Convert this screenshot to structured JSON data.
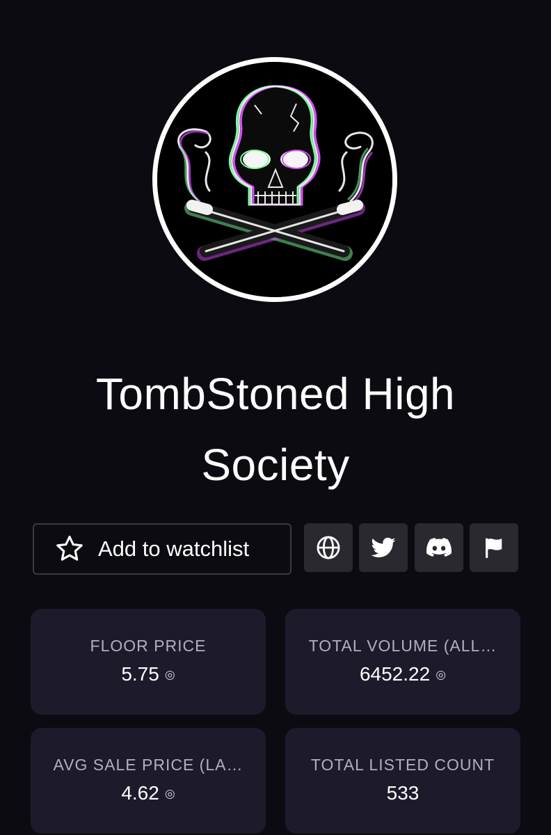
{
  "collection": {
    "name": "TombStoned High Society",
    "avatar_icon": "skull-crossbones-logo"
  },
  "actions": {
    "watchlist_label": "Add to watchlist",
    "watchlist_icon": "star-icon",
    "links": [
      {
        "name": "website",
        "icon": "globe-icon"
      },
      {
        "name": "twitter",
        "icon": "twitter-icon"
      },
      {
        "name": "discord",
        "icon": "discord-icon"
      },
      {
        "name": "report",
        "icon": "flag-icon"
      }
    ]
  },
  "stats": [
    {
      "label": "FLOOR PRICE",
      "value": "5.75",
      "currency_icon": "◎"
    },
    {
      "label": "TOTAL VOLUME (ALL…",
      "value": "6452.22",
      "currency_icon": "◎"
    },
    {
      "label": "AVG SALE PRICE (LA…",
      "value": "4.62",
      "currency_icon": "◎"
    },
    {
      "label": "TOTAL LISTED COUNT",
      "value": "533"
    }
  ],
  "colors": {
    "background": "#0c0b11",
    "card": "#1d1b2b",
    "icon_button": "#2a2930",
    "accent_green": "#7dffa0",
    "accent_magenta": "#d84cff"
  }
}
